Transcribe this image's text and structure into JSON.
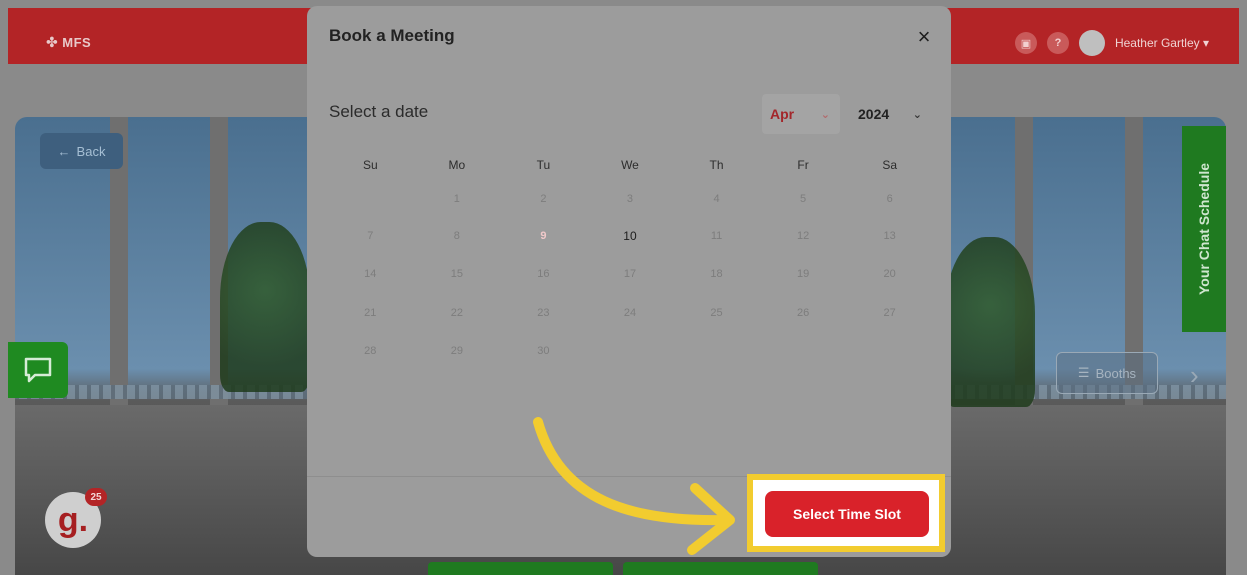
{
  "topbar": {
    "logo": "MFS",
    "icons": [
      "chat-icon",
      "help-icon"
    ],
    "help_label": "?",
    "user_name": "Heather Gartley ▾"
  },
  "hall": {
    "back_label": "Back",
    "chat_schedule_label": "Your Chat Schedule",
    "booths_label": "Booths",
    "g_logo": "g.",
    "g_badge": "25"
  },
  "modal": {
    "title": "Book a Meeting",
    "close": "×",
    "date_prompt": "Select a date",
    "month": "Apr",
    "year": "2024",
    "weekdays": [
      "Su",
      "Mo",
      "Tu",
      "We",
      "Th",
      "Fr",
      "Sa"
    ],
    "weeks": [
      [
        "",
        "1",
        "2",
        "3",
        "4",
        "5",
        "6"
      ],
      [
        "7",
        "8",
        "9",
        "10",
        "11",
        "12",
        "13"
      ],
      [
        "14",
        "15",
        "16",
        "17",
        "18",
        "19",
        "20"
      ],
      [
        "21",
        "22",
        "23",
        "24",
        "25",
        "26",
        "27"
      ],
      [
        "28",
        "29",
        "30",
        "",
        "",
        "",
        ""
      ]
    ],
    "selected_day": "9",
    "highlighted_day": "10",
    "action_button": "Select Time Slot"
  },
  "colors": {
    "brand_red": "#b32426",
    "action_red": "#d9222a",
    "highlight_yellow": "#f2cc2f",
    "green": "#1f7a20"
  }
}
